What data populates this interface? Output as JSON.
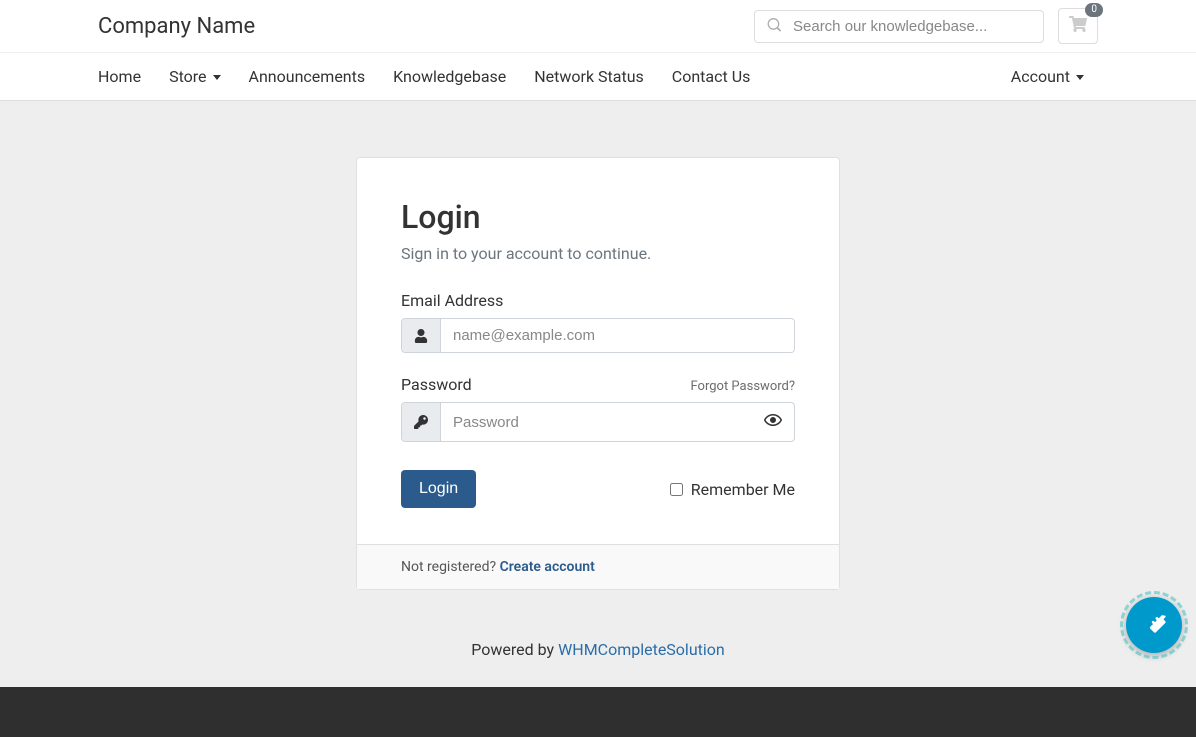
{
  "header": {
    "brand": "Company Name",
    "search_placeholder": "Search our knowledgebase...",
    "cart_count": "0"
  },
  "nav": {
    "home": "Home",
    "store": "Store",
    "announcements": "Announcements",
    "knowledgebase": "Knowledgebase",
    "network_status": "Network Status",
    "contact_us": "Contact Us",
    "account": "Account"
  },
  "login": {
    "title": "Login",
    "subtitle": "Sign in to your account to continue.",
    "email_label": "Email Address",
    "email_placeholder": "name@example.com",
    "password_label": "Password",
    "password_placeholder": "Password",
    "forgot": "Forgot Password?",
    "login_button": "Login",
    "remember": "Remember Me",
    "not_registered": "Not registered? ",
    "create_account": "Create account"
  },
  "footer": {
    "powered_by": "Powered by ",
    "whmcs": "WHMCompleteSolution"
  }
}
